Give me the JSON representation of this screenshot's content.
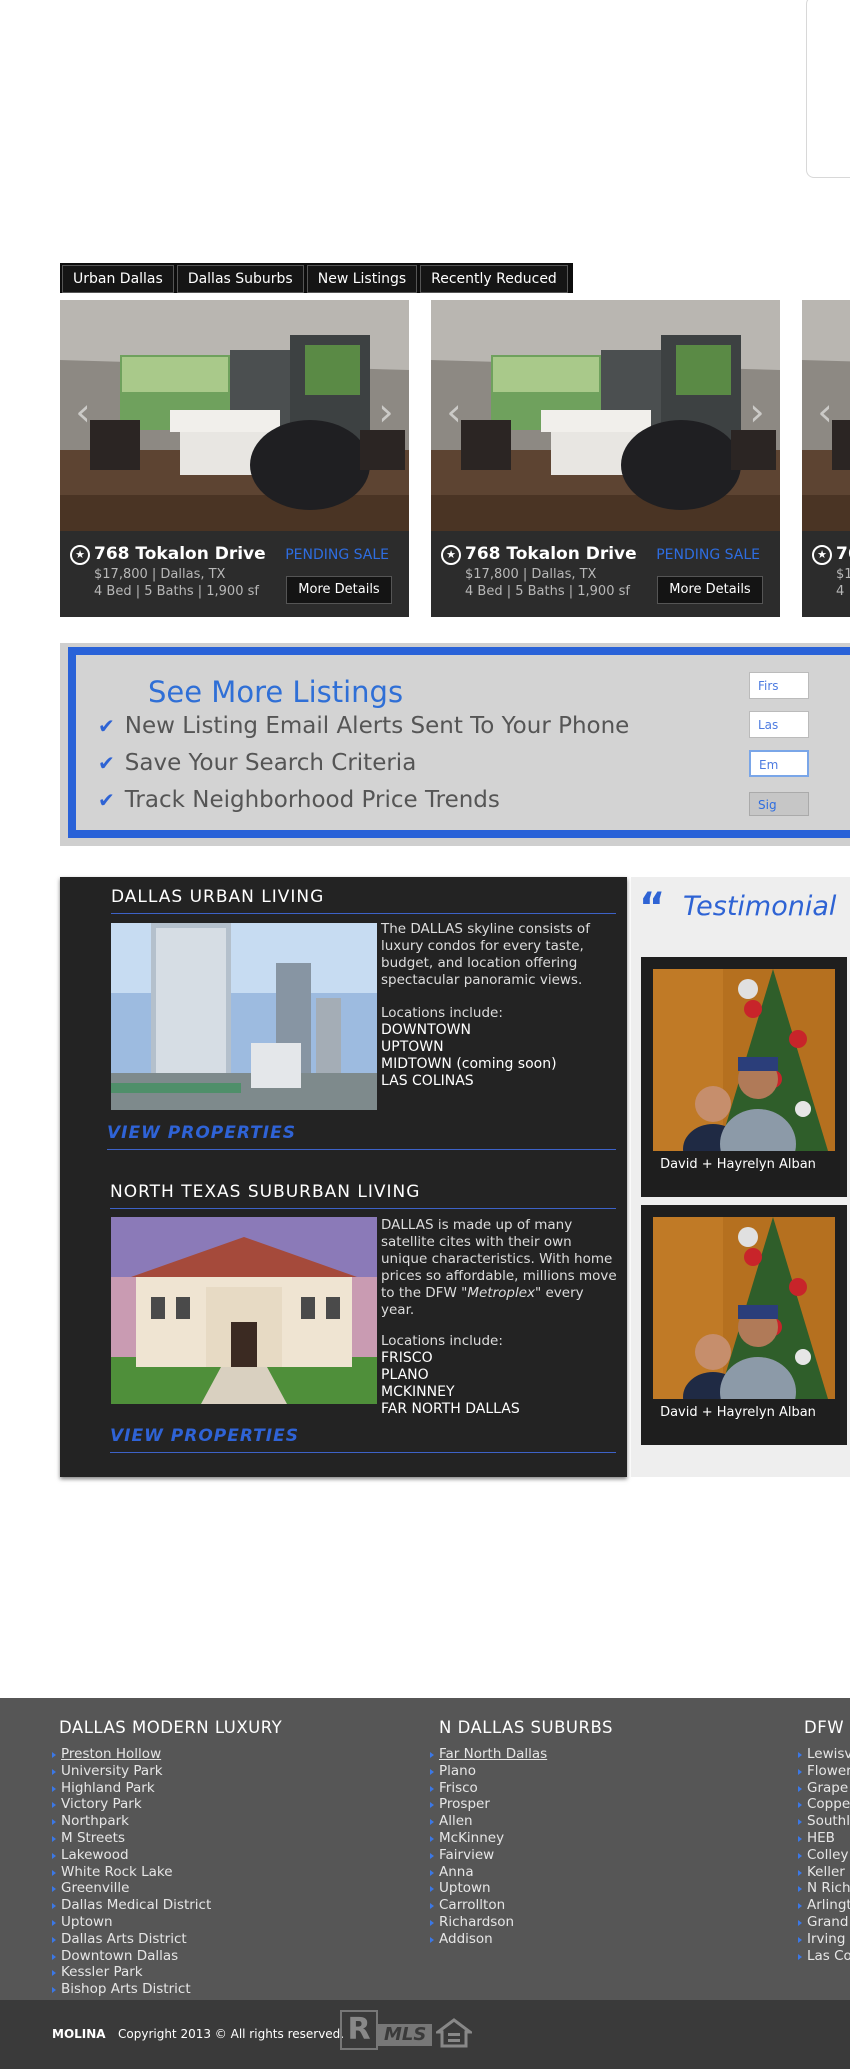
{
  "tabs": [
    "Urban Dallas",
    "Dallas Suburbs",
    "New Listings",
    "Recently Reduced"
  ],
  "listings": [
    {
      "address": "768 Tokalon Drive",
      "status": "PENDING SALE",
      "price": "$17,800 | Dallas, TX",
      "specs": "4 Bed | 5 Baths | 1,900 sf",
      "button": "More Details"
    },
    {
      "address": "768 Tokalon Drive",
      "status": "PENDING SALE",
      "price": "$17,800 | Dallas, TX",
      "specs": "4 Bed | 5 Baths | 1,900 sf",
      "button": "More Details"
    },
    {
      "address": "76",
      "price": "$1",
      "specs": "4"
    }
  ],
  "cta": {
    "title": "See More Listings",
    "items": [
      "New Listing Email Alerts Sent To Your Phone",
      "Save Your Search Criteria",
      "Track Neighborhood Price Trends"
    ],
    "fields": [
      "Firs",
      "Las",
      "Em"
    ],
    "signup": "Sig"
  },
  "urban": {
    "title": "DALLAS URBAN LIVING",
    "text": "The DALLAS skyline consists of luxury condos for every taste, budget, and location offering spectacular panoramic views.",
    "loc_label": "Locations include:",
    "locations": [
      "DOWNTOWN",
      "UPTOWN",
      "MIDTOWN (coming soon)",
      "LAS COLINAS"
    ],
    "view": "VIEW PROPERTIES"
  },
  "suburban": {
    "title": "NORTH TEXAS SUBURBAN LIVING",
    "text_a": "DALLAS is made up of many satellite cites with their own unique characteristics. With home prices so affordable, millions move to the DFW",
    "text_em": "\"Metroplex\"",
    "text_b": "every year.",
    "loc_label": "Locations include:",
    "locations": [
      "FRISCO",
      "PLANO",
      "MCKINNEY",
      "FAR NORTH DALLAS"
    ],
    "view": "VIEW PROPERTIES"
  },
  "testimonials": {
    "quote": "“",
    "title": "Testimonial",
    "items": [
      {
        "caption": "David + Hayrelyn Alban"
      },
      {
        "caption": "David + Hayrelyn Alban"
      }
    ]
  },
  "footer": {
    "columns": [
      {
        "title": "DALLAS MODERN LUXURY",
        "items": [
          "Preston Hollow",
          "University Park",
          "Highland Park",
          "Victory Park",
          "Northpark",
          "M Streets",
          "Lakewood",
          "White Rock Lake",
          "Greenville",
          "Dallas Medical District",
          "Uptown",
          "Dallas Arts District",
          "Downtown Dallas",
          "Kessler Park",
          "Bishop Arts District"
        ]
      },
      {
        "title": "N DALLAS SUBURBS",
        "items": [
          "Far North Dallas",
          "Plano",
          "Frisco",
          "Prosper",
          "Allen",
          "McKinney",
          "Fairview",
          "Anna",
          "Uptown",
          "Carrollton",
          "Richardson",
          "Addison"
        ]
      },
      {
        "title": "DFW",
        "items": [
          "Lewisv",
          "Flower",
          "Grape",
          "Coppe",
          "Southl",
          "HEB",
          "Colley",
          "Keller",
          "N Richl",
          "Arlingt",
          "Grand",
          "Irving",
          "Las Co"
        ]
      }
    ],
    "brand": "MOLINA",
    "copyright": "Copyright 2013  © All rights reserved.",
    "logo_r": "R",
    "logo_mls": "MLS"
  },
  "colors": {
    "accent": "#2e63d4",
    "dark_panel": "#232323",
    "footer": "#565656"
  }
}
